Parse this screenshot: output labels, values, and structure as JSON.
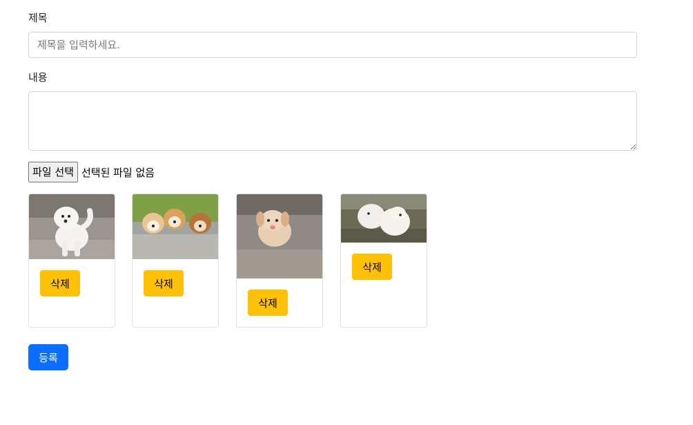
{
  "form": {
    "title_label": "제목",
    "title_placeholder": "제목을 입력하세요.",
    "title_value": "",
    "content_label": "내용",
    "content_value": "",
    "file_button_label": "파일 선택",
    "file_status": "선택된 파일 없음",
    "submit_label": "등록"
  },
  "images": [
    {
      "alt": "white puppy standing",
      "delete_label": "삭제"
    },
    {
      "alt": "three puppies on grass",
      "delete_label": "삭제"
    },
    {
      "alt": "cream puppy on gravel",
      "delete_label": "삭제"
    },
    {
      "alt": "two white puppies",
      "delete_label": "삭제"
    }
  ],
  "colors": {
    "primary": "#0d6efd",
    "warning": "#ffc107",
    "border": "#ced4da"
  }
}
